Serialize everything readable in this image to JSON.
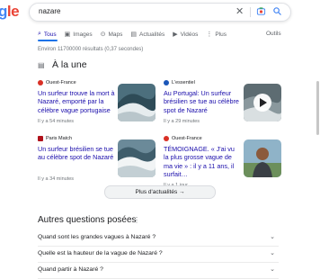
{
  "header": {
    "logo_part1": "g",
    "logo_part2": "le",
    "query": "nazare"
  },
  "tabs": [
    {
      "label": "Tous",
      "icon": "search-icon",
      "active": true
    },
    {
      "label": "Images",
      "icon": "image-icon"
    },
    {
      "label": "Maps",
      "icon": "map-pin-icon"
    },
    {
      "label": "Actualités",
      "icon": "news-icon"
    },
    {
      "label": "Vidéos",
      "icon": "video-icon"
    },
    {
      "label": "Plus",
      "icon": "more-vert-icon"
    }
  ],
  "tools_label": "Outils",
  "result_stats": "Environ 11700000 résultats (0,37 secondes)",
  "top_stories": {
    "title": "À la une",
    "stories": [
      {
        "source": "Ouest-France",
        "source_color": "#d93025",
        "headline": "Un surfeur trouve la mort à Nazaré, emporté par la célèbre vague portugaise",
        "time": "Il y a 54 minutes",
        "thumb": "wave"
      },
      {
        "source": "L'essentiel",
        "source_color": "#1a56b8",
        "headline": "Au Portugal: Un surfeur brésilien se tue au célèbre spot de Nazaré",
        "time": "Il y a 29 minutes",
        "thumb": "video"
      },
      {
        "source": "Paris Match",
        "source_color": "#b0121b",
        "headline": "Un surfeur brésilien se tue au célèbre spot de Nazaré",
        "time": "Il y a 34 minutes",
        "thumb": "wave2"
      },
      {
        "source": "Ouest-France",
        "source_color": "#d93025",
        "headline": "TÉMOIGNAGE. « J'ai vu la plus grosse vague de ma vie » : il y a 11 ans, il surfait…",
        "time": "Il y a 1 jour",
        "thumb": "person"
      }
    ],
    "more_label": "Plus d'actualités"
  },
  "paa": {
    "title": "Autres questions posées",
    "questions": [
      "Quand sont les grandes vagues à Nazaré ?",
      "Quelle est la hauteur de la vague de Nazaré ?",
      "Quand partir à Nazaré ?"
    ]
  }
}
